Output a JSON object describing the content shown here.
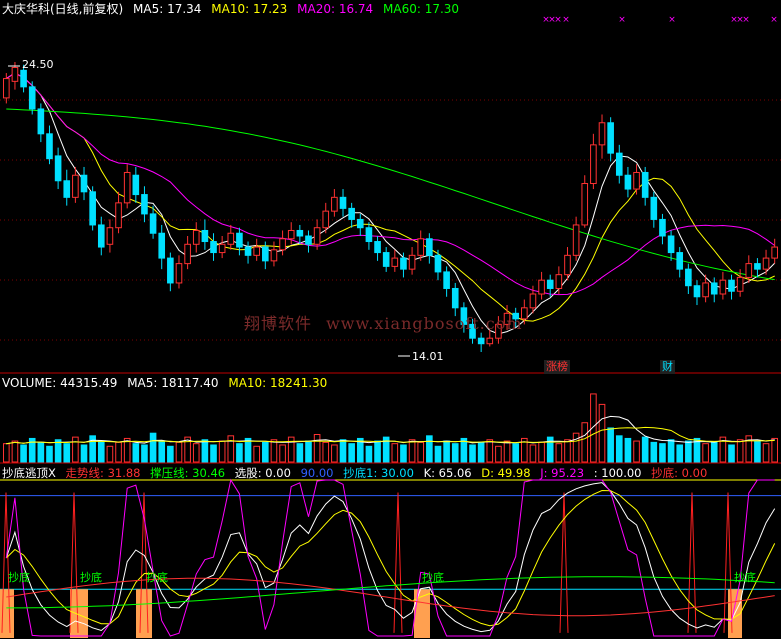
{
  "price_header": {
    "name": "大庆华科(日线,前复权)",
    "ma5": "MA5: 17.34",
    "ma10": "MA10: 17.23",
    "ma20": "MA20: 16.74",
    "ma60": "MA60: 17.30"
  },
  "volume_header": {
    "volume": "VOLUME: 44315.49",
    "ma5": "MA5: 18117.40",
    "ma10": "MA10: 18241.30"
  },
  "indicator_header": {
    "name": "抄底逃顶X",
    "trend": "走势线: 31.88",
    "pressure": "撑压线: 30.46",
    "select": "选股: 0.00",
    "level90": "90.00",
    "chaodi1": "抄底1: 30.00",
    "k": "K: 65.06",
    "d": "D: 49.98",
    "j": "J: 95.23",
    "level100": ": 100.00",
    "chaodi": "抄底: 0.00"
  },
  "watermark": {
    "cn": "翔博软件",
    "url": "www.xiangbosoft.com"
  },
  "annotations": {
    "high": "24.50",
    "low": "14.01",
    "zhangbang": "涨榜",
    "cai": "财",
    "chaodi_labels": [
      "抄底",
      "抄底",
      "抄底",
      "抄底",
      "抄底"
    ]
  },
  "colors": {
    "up": "#ff3232",
    "down": "#00e0ff",
    "ma5": "#ffffff",
    "ma10": "#ffff00",
    "ma20": "#ff00ff",
    "ma60": "#00ff00",
    "grid": "#800000"
  },
  "chart_data": {
    "type": "candlestick",
    "price_axis": {
      "high": 24.5,
      "low": 14.01
    },
    "candles": [
      [
        23.2,
        23.9,
        23.0,
        24.1
      ],
      [
        23.8,
        24.3,
        23.5,
        24.5
      ],
      [
        24.2,
        23.6,
        23.4,
        24.4
      ],
      [
        23.6,
        22.8,
        22.6,
        23.8
      ],
      [
        22.8,
        21.9,
        21.6,
        23.0
      ],
      [
        21.9,
        21.0,
        20.8,
        22.2
      ],
      [
        21.1,
        20.2,
        19.9,
        21.4
      ],
      [
        20.2,
        19.6,
        19.3,
        20.6
      ],
      [
        19.6,
        20.4,
        19.4,
        20.7
      ],
      [
        20.4,
        19.8,
        19.5,
        20.7
      ],
      [
        19.8,
        18.6,
        18.4,
        20.0
      ],
      [
        18.6,
        17.8,
        17.5,
        18.9
      ],
      [
        17.9,
        18.5,
        17.6,
        18.8
      ],
      [
        18.5,
        19.4,
        18.3,
        19.8
      ],
      [
        19.4,
        20.5,
        19.2,
        20.8
      ],
      [
        20.4,
        19.7,
        19.4,
        20.7
      ],
      [
        19.7,
        19.0,
        18.7,
        20.0
      ],
      [
        19.0,
        18.3,
        18.1,
        19.3
      ],
      [
        18.3,
        17.4,
        17.0,
        18.6
      ],
      [
        17.4,
        16.5,
        16.2,
        17.6
      ],
      [
        16.5,
        17.2,
        16.3,
        17.5
      ],
      [
        17.2,
        17.9,
        17.0,
        18.2
      ],
      [
        17.9,
        18.4,
        17.6,
        18.7
      ],
      [
        18.4,
        18.0,
        17.7,
        18.8
      ],
      [
        18.0,
        17.6,
        17.3,
        18.3
      ],
      [
        17.6,
        17.9,
        17.4,
        18.2
      ],
      [
        17.9,
        18.3,
        17.7,
        18.6
      ],
      [
        18.3,
        17.8,
        17.5,
        18.5
      ],
      [
        17.8,
        17.5,
        17.2,
        18.0
      ],
      [
        17.5,
        17.8,
        17.3,
        18.1
      ],
      [
        17.8,
        17.3,
        17.0,
        18.0
      ],
      [
        17.3,
        17.7,
        17.1,
        18.0
      ],
      [
        17.7,
        18.1,
        17.5,
        18.4
      ],
      [
        18.1,
        18.4,
        17.9,
        18.7
      ],
      [
        18.4,
        18.2,
        17.9,
        18.6
      ],
      [
        18.2,
        17.9,
        17.6,
        18.4
      ],
      [
        17.9,
        18.5,
        17.7,
        18.8
      ],
      [
        18.5,
        19.1,
        18.3,
        19.4
      ],
      [
        19.1,
        19.6,
        18.9,
        19.9
      ],
      [
        19.6,
        19.2,
        18.9,
        19.9
      ],
      [
        19.2,
        18.8,
        18.5,
        19.4
      ],
      [
        18.8,
        18.5,
        18.2,
        19.0
      ],
      [
        18.5,
        18.0,
        17.7,
        18.7
      ],
      [
        18.0,
        17.6,
        17.3,
        18.2
      ],
      [
        17.6,
        17.1,
        16.9,
        17.8
      ],
      [
        17.1,
        17.4,
        16.9,
        17.7
      ],
      [
        17.4,
        17.0,
        16.7,
        17.6
      ],
      [
        17.0,
        17.5,
        16.8,
        17.8
      ],
      [
        17.5,
        18.1,
        17.3,
        18.4
      ],
      [
        18.1,
        17.5,
        17.2,
        18.3
      ],
      [
        17.5,
        16.9,
        16.6,
        17.7
      ],
      [
        16.9,
        16.3,
        16.0,
        17.1
      ],
      [
        16.3,
        15.6,
        15.3,
        16.5
      ],
      [
        15.6,
        15.0,
        14.7,
        15.8
      ],
      [
        15.0,
        14.5,
        14.3,
        15.2
      ],
      [
        14.5,
        14.3,
        14.0,
        14.7
      ],
      [
        14.3,
        14.5,
        14.2,
        14.8
      ],
      [
        14.5,
        15.0,
        14.3,
        15.3
      ],
      [
        15.0,
        15.4,
        14.8,
        15.7
      ],
      [
        15.4,
        15.2,
        14.9,
        15.6
      ],
      [
        15.2,
        15.6,
        15.0,
        15.9
      ],
      [
        15.6,
        16.1,
        15.4,
        16.4
      ],
      [
        16.1,
        16.6,
        15.9,
        16.9
      ],
      [
        16.6,
        16.3,
        16.0,
        16.8
      ],
      [
        16.3,
        16.8,
        16.1,
        17.1
      ],
      [
        16.8,
        17.5,
        16.6,
        17.8
      ],
      [
        17.5,
        18.6,
        17.3,
        18.9
      ],
      [
        18.6,
        20.1,
        18.5,
        20.4
      ],
      [
        20.1,
        21.5,
        19.9,
        21.9
      ],
      [
        21.5,
        22.3,
        21.0,
        22.6
      ],
      [
        22.3,
        21.2,
        20.9,
        22.5
      ],
      [
        21.2,
        20.4,
        20.1,
        21.5
      ],
      [
        20.4,
        19.9,
        19.6,
        20.7
      ],
      [
        19.9,
        20.5,
        19.7,
        20.8
      ],
      [
        20.5,
        19.6,
        19.3,
        20.7
      ],
      [
        19.6,
        18.8,
        18.5,
        19.8
      ],
      [
        18.8,
        18.2,
        17.9,
        19.0
      ],
      [
        18.2,
        17.6,
        17.3,
        18.4
      ],
      [
        17.6,
        17.0,
        16.7,
        17.8
      ],
      [
        17.0,
        16.4,
        16.1,
        17.2
      ],
      [
        16.4,
        16.0,
        15.7,
        16.6
      ],
      [
        16.0,
        16.5,
        15.8,
        16.8
      ],
      [
        16.5,
        16.1,
        15.8,
        16.7
      ],
      [
        16.1,
        16.6,
        15.9,
        16.9
      ],
      [
        16.6,
        16.2,
        15.9,
        16.8
      ],
      [
        16.2,
        16.7,
        16.0,
        17.0
      ],
      [
        16.7,
        17.2,
        16.5,
        17.5
      ],
      [
        17.2,
        17.0,
        16.7,
        17.4
      ],
      [
        17.0,
        17.4,
        16.8,
        17.7
      ],
      [
        17.4,
        17.8,
        17.2,
        18.1
      ]
    ],
    "volume": [
      14,
      16,
      13,
      18,
      15,
      12,
      17,
      14,
      19,
      13,
      20,
      16,
      12,
      15,
      18,
      14,
      13,
      22,
      16,
      12,
      15,
      19,
      14,
      17,
      13,
      16,
      20,
      14,
      18,
      12,
      15,
      17,
      13,
      19,
      14,
      16,
      21,
      15,
      13,
      17,
      14,
      18,
      12,
      16,
      19,
      14,
      13,
      17,
      15,
      20,
      12,
      16,
      14,
      18,
      13,
      15,
      17,
      12,
      16,
      14,
      18,
      13,
      15,
      19,
      14,
      17,
      22,
      30,
      52,
      44,
      26,
      20,
      18,
      16,
      19,
      15,
      14,
      17,
      13,
      16,
      18,
      14,
      15,
      19,
      13,
      17,
      20,
      16,
      14,
      18
    ],
    "volume_ma5": 18117.4,
    "volume_ma10": 18241.3,
    "indicator": {
      "k": 65.06,
      "d": 49.98,
      "j": 95.23,
      "trend": 31.88,
      "pressure": 30.46,
      "chaodi1": 30.0,
      "levels": [
        90,
        100
      ]
    }
  }
}
